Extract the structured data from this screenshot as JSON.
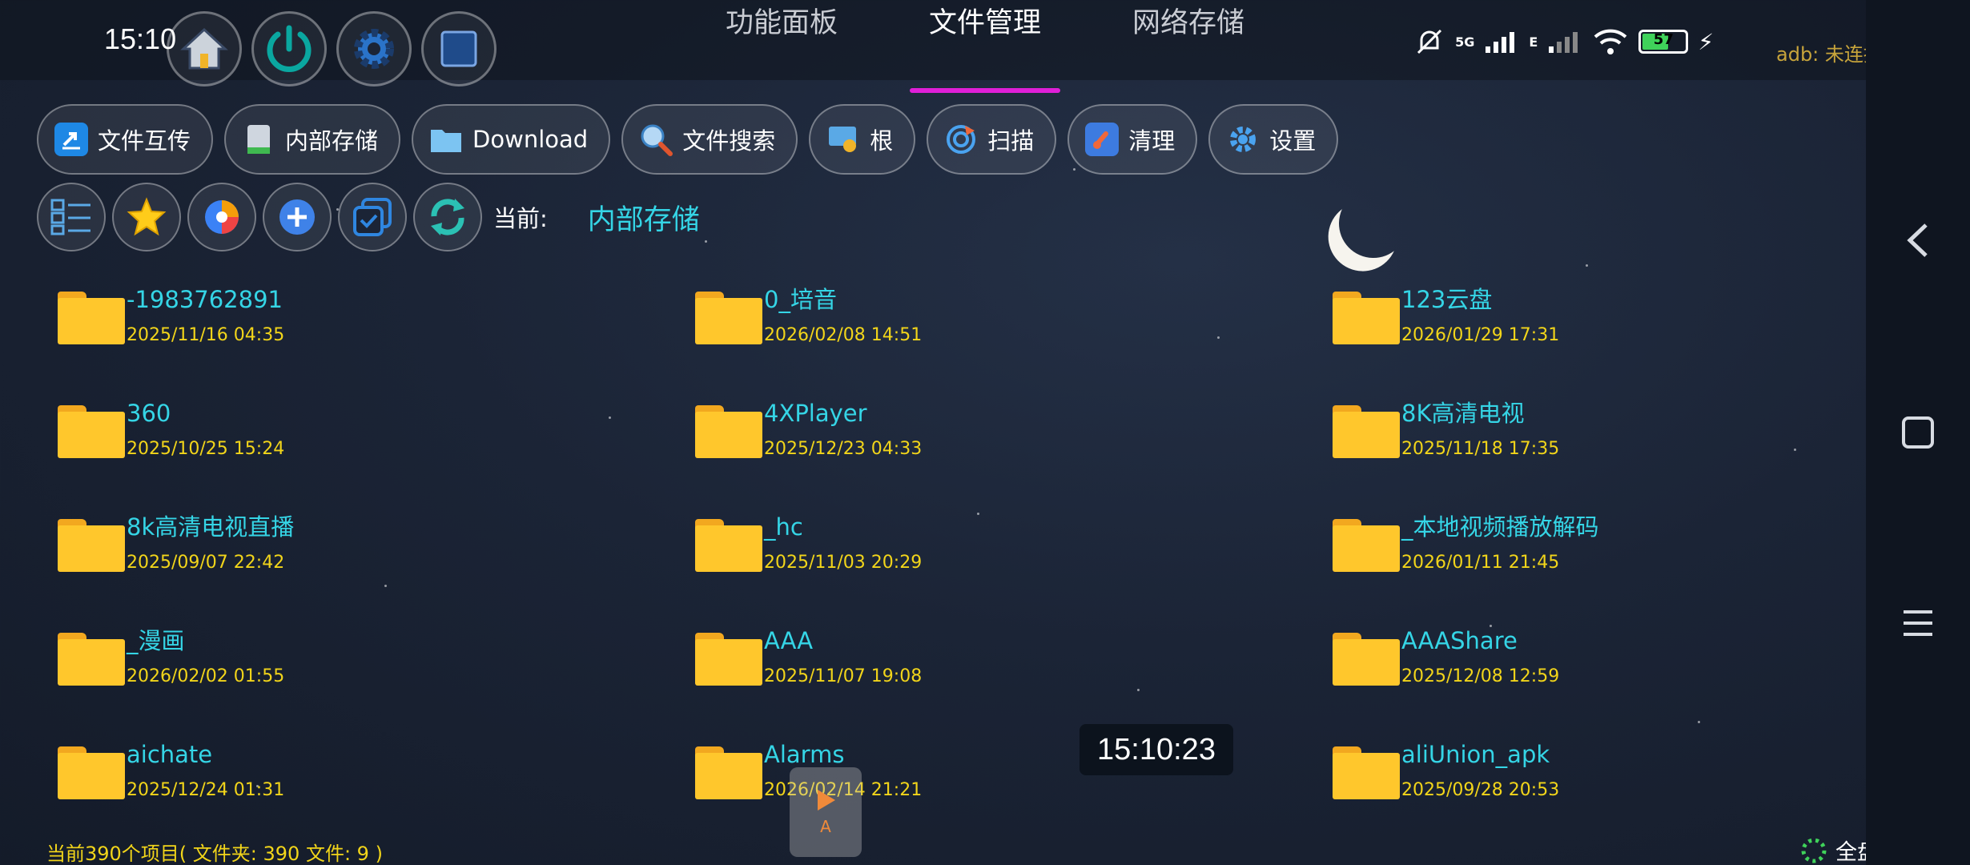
{
  "status_bar": {
    "time": "15:10",
    "network": "5G",
    "network_secondary": "E",
    "battery": "57",
    "adb_status": "adb: 未连接"
  },
  "quick_buttons": [
    {
      "icon": "home-icon"
    },
    {
      "icon": "power-icon"
    },
    {
      "icon": "gear-icon"
    },
    {
      "icon": "square-icon"
    }
  ],
  "tabs": [
    {
      "label": "功能面板",
      "active": false
    },
    {
      "label": "文件管理",
      "active": true
    },
    {
      "label": "网络存储",
      "active": false
    }
  ],
  "toolbar": [
    {
      "label": "文件互传",
      "icon": "share-icon"
    },
    {
      "label": "内部存储",
      "icon": "storage-icon"
    },
    {
      "label": "Download",
      "icon": "folder-icon"
    },
    {
      "label": "文件搜索",
      "icon": "search-icon"
    },
    {
      "label": "根",
      "icon": "root-icon"
    },
    {
      "label": "扫描",
      "icon": "scan-icon"
    },
    {
      "label": "清理",
      "icon": "broom-icon"
    },
    {
      "label": "设置",
      "icon": "settings-icon"
    }
  ],
  "icon_row": [
    {
      "icon": "list-view-icon"
    },
    {
      "icon": "star-icon"
    },
    {
      "icon": "pie-chart-icon"
    },
    {
      "icon": "plus-icon"
    },
    {
      "icon": "multi-select-icon"
    },
    {
      "icon": "refresh-icon"
    }
  ],
  "current": {
    "label": "当前:",
    "path": "内部存储"
  },
  "files": [
    {
      "name": "-1983762891",
      "date": "2025/11/16 04:35"
    },
    {
      "name": "0_培音",
      "date": "2026/02/08 14:51"
    },
    {
      "name": "123云盘",
      "date": "2026/01/29 17:31"
    },
    {
      "name": "360",
      "date": "2025/10/25 15:24"
    },
    {
      "name": "4XPlayer",
      "date": "2025/12/23 04:33"
    },
    {
      "name": "8K高清电视",
      "date": "2025/11/18 17:35"
    },
    {
      "name": "8k高清电视直播",
      "date": "2025/09/07 22:42"
    },
    {
      "name": "_hc",
      "date": "2025/11/03 20:29"
    },
    {
      "name": "_本地视频播放解码",
      "date": "2026/01/11 21:45"
    },
    {
      "name": "_漫画",
      "date": "2026/02/02 01:55"
    },
    {
      "name": "AAA",
      "date": "2025/11/07 19:08"
    },
    {
      "name": "AAAShare",
      "date": "2025/12/08 12:59"
    },
    {
      "name": "aichate",
      "date": "2025/12/24 01:31"
    },
    {
      "name": "Alarms",
      "date": "2026/02/14 21:21"
    },
    {
      "name": "aliUnion_apk",
      "date": "2025/09/28 20:53"
    }
  ],
  "overlay_time": "15:10:23",
  "float_button": {
    "label": "A"
  },
  "footer": {
    "summary": "当前390个项目( 文件夹: 390   文件: 9 )",
    "scan_status": "全盘扫描中..."
  },
  "colors": {
    "accent_tab": "#e01fd8",
    "file_name": "#35d5e6",
    "file_date": "#f2d51a",
    "folder": "#ffc72c"
  }
}
